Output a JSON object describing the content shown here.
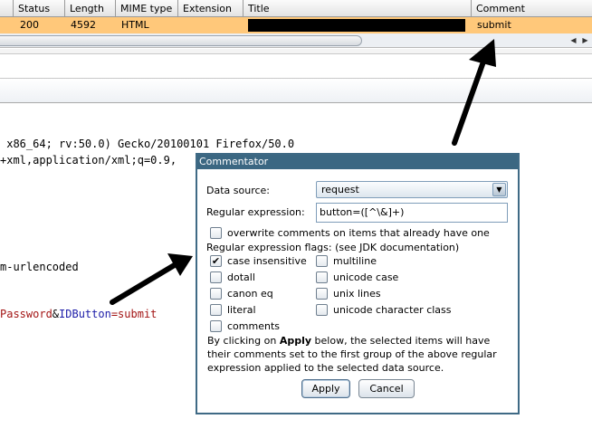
{
  "table": {
    "columns": [
      "Status",
      "Length",
      "MIME type",
      "Extension",
      "Title",
      "Comment"
    ],
    "row": {
      "status": "200",
      "length": "4592",
      "mime": "HTML",
      "extension": "",
      "title": "",
      "comment": "submit"
    },
    "row_color": "#ffc87a"
  },
  "request_text": {
    "line1": " x86_64; rv:50.0) Gecko/20100101 Firefox/50.0",
    "line2": "+xml,application/xml;q=0.9,",
    "line3": "m-urlencoded",
    "line4_a": "Password",
    "line4_b": "&",
    "line4_c": "IDButton",
    "line4_d": "=submit"
  },
  "dialog": {
    "title": "Commentator",
    "data_source_label": "Data source:",
    "data_source_value": "request",
    "regex_label": "Regular expression:",
    "regex_value": "button=([^\\&]+)",
    "overwrite_label": "overwrite comments on items that already have one",
    "flags_label": "Regular expression flags: (see JDK documentation)",
    "flags": {
      "case_insensitive": {
        "label": "case insensitive",
        "checked": true
      },
      "multiline": {
        "label": "multiline",
        "checked": false
      },
      "dotall": {
        "label": "dotall",
        "checked": false
      },
      "unicode_case": {
        "label": "unicode case",
        "checked": false
      },
      "canon_eq": {
        "label": "canon eq",
        "checked": false
      },
      "unix_lines": {
        "label": "unix lines",
        "checked": false
      },
      "literal": {
        "label": "literal",
        "checked": false
      },
      "unicode_character_class": {
        "label": "unicode character class",
        "checked": false
      },
      "comments": {
        "label": "comments",
        "checked": false
      }
    },
    "description_pre": "By clicking on ",
    "description_bold": "Apply",
    "description_post": " below, the selected items will have their comments set to the first group of the above regular expression applied to the selected data source.",
    "apply_label": "Apply",
    "cancel_label": "Cancel",
    "title_color": "#3b6782"
  },
  "icons": {
    "dropdown": "chevron-down-icon",
    "check": "checkmark-icon",
    "scroll_left": "scroll-left-icon",
    "scroll_right": "scroll-right-icon"
  }
}
